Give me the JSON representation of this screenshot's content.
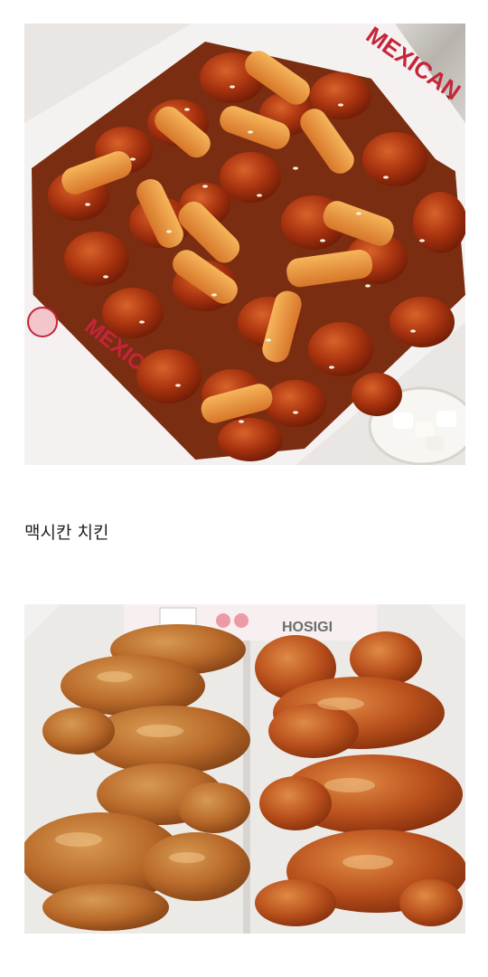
{
  "caption": "맥시칸 치킨",
  "photo_1": {
    "brand_text": "MEXICAN"
  },
  "photo_2": {
    "brand_text": "HOSIGI"
  },
  "colors": {
    "sauce": "#a8330f",
    "tteok": "#e48a2e",
    "fried_chicken": "#b96a2a",
    "box_white": "#f4f2f1",
    "brand_red": "#c5253a"
  }
}
